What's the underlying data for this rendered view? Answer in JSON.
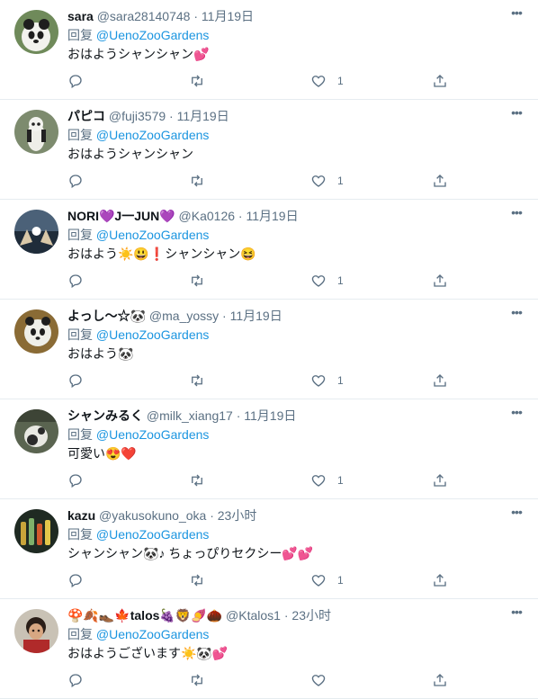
{
  "tweets": [
    {
      "name": "sara",
      "handle": "@sara28140748",
      "time": "11月19日",
      "reply_prefix": "回复",
      "reply_to": "@UenoZooGardens",
      "text": "おはようシャンシャン💕",
      "likes": "1"
    },
    {
      "name": "パピコ",
      "handle": "@fuji3579",
      "time": "11月19日",
      "reply_prefix": "回复",
      "reply_to": "@UenoZooGardens",
      "text": "おはようシャンシャン",
      "likes": "1"
    },
    {
      "name": "NORI💜J一JUN💜",
      "handle": "@Ka0126",
      "time": "11月19日",
      "reply_prefix": "回复",
      "reply_to": "@UenoZooGardens",
      "text": "おはよう☀️😃❗️シャンシャン😆",
      "likes": "1"
    },
    {
      "name": "よっし～☆🐼",
      "handle": "@ma_yossy",
      "time": "11月19日",
      "reply_prefix": "回复",
      "reply_to": "@UenoZooGardens",
      "text": "おはよう🐼",
      "likes": "1"
    },
    {
      "name": "シャンみるく",
      "handle": "@milk_xiang17",
      "time": "11月19日",
      "reply_prefix": "回复",
      "reply_to": "@UenoZooGardens",
      "text": "可愛い😍❤️",
      "likes": "1"
    },
    {
      "name": "kazu",
      "handle": "@yakusokuno_oka",
      "time": "23小时",
      "reply_prefix": "回复",
      "reply_to": "@UenoZooGardens",
      "text": "シャンシャン🐼♪ ちょっぴりセクシー💕💕",
      "likes": "1"
    },
    {
      "name": "🍄🍂👞🍁talos🍇🦁🍠🌰",
      "handle": "@Ktalos1",
      "time": "23小时",
      "reply_prefix": "回复",
      "reply_to": "@UenoZooGardens",
      "text": "おはようございます☀️🐼💕",
      "likes": ""
    }
  ],
  "separator": "·",
  "more_glyph": "•••",
  "icons": {
    "reply": "reply-icon",
    "retweet": "retweet-icon",
    "like": "heart-icon",
    "share": "share-icon",
    "more": "more-icon"
  },
  "colors": {
    "text": "#0f1419",
    "secondary": "#5b7083",
    "mention": "#1b95e0",
    "divider": "#e6ecf0"
  }
}
